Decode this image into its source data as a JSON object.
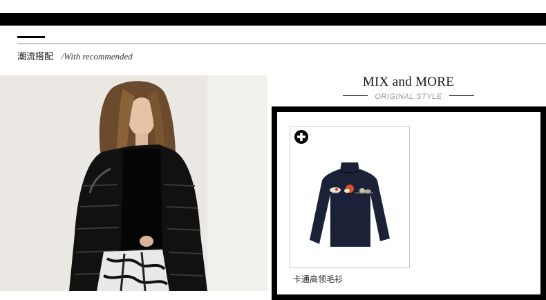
{
  "header": {
    "section_title_zh": "潮流搭配",
    "section_title_en": "/With recommended"
  },
  "feature": {
    "title": "MIX and MORE",
    "subtitle": "ORIGINAL STYLE"
  },
  "products": [
    {
      "name": "卡通高领毛衫",
      "icon": "plus-circle-icon"
    }
  ],
  "colors": {
    "bar": "#000000",
    "subtitle": "#999999",
    "card_border": "#c9c9c9",
    "sweater": "#1b2238"
  }
}
